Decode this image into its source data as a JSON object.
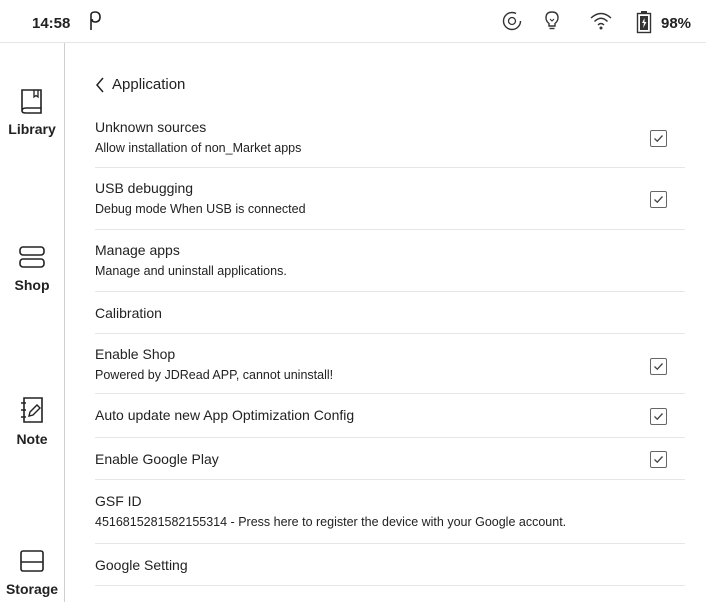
{
  "status_bar": {
    "time": "14:58",
    "battery_percent": "98%",
    "icons": [
      "p-app-icon",
      "sync-icon",
      "bulb-icon",
      "wifi-icon",
      "battery-icon"
    ]
  },
  "sidebar": {
    "items": [
      {
        "label": "Library",
        "icon": "book-icon"
      },
      {
        "label": "Shop",
        "icon": "shop-icon"
      },
      {
        "label": "Note",
        "icon": "note-icon"
      },
      {
        "label": "Storage",
        "icon": "storage-icon"
      }
    ]
  },
  "header": {
    "title": "Application",
    "back_icon": "chevron-left-icon"
  },
  "settings": [
    {
      "title": "Unknown sources",
      "subtitle": "Allow installation of non_Market apps",
      "checked": true
    },
    {
      "title": "USB debugging",
      "subtitle": "Debug mode When USB is connected",
      "checked": true
    },
    {
      "title": "Manage apps",
      "subtitle": "Manage and uninstall applications."
    },
    {
      "title": "Calibration"
    },
    {
      "title": "Enable Shop",
      "subtitle": "Powered by JDRead APP, cannot uninstall!",
      "checked": true
    },
    {
      "title": "Auto update new App Optimization Config",
      "checked": true
    },
    {
      "title": "Enable Google Play",
      "checked": true
    },
    {
      "title": "GSF ID",
      "subtitle": "4516815281582155314 - Press here to register the device with your Google account."
    },
    {
      "title": "Google Setting"
    }
  ]
}
